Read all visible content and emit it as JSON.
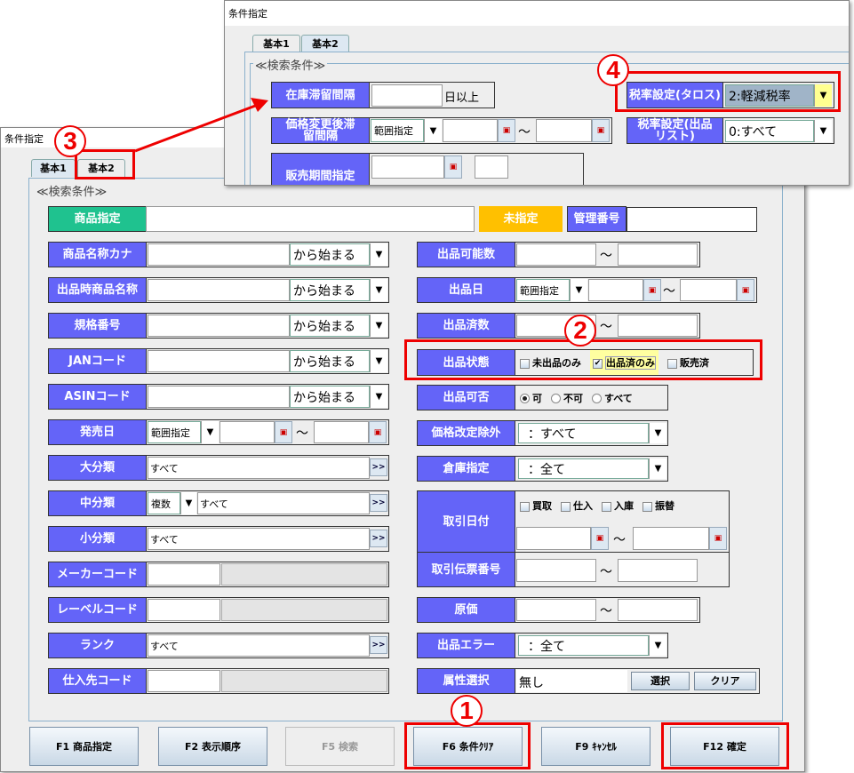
{
  "back_window": {
    "title": "条件指定",
    "tabs": [
      "基本1",
      "基本2"
    ],
    "group_label": "≪検索条件≫",
    "left": {
      "product_spec": "商品指定",
      "unspecified": "未指定",
      "mgmt_no": "管理番号",
      "name_kana": "商品名称カナ",
      "listing_name": "出品時商品名称",
      "model_no": "規格番号",
      "jan": "JANコード",
      "asin": "ASINコード",
      "match_option": "から始まる",
      "release_date": "発売日",
      "range": "範囲指定",
      "large_cat": "大分類",
      "all": "すべて",
      "mid_cat": "中分類",
      "multiple": "複数",
      "small_cat": "小分類",
      "maker_code": "メーカーコード",
      "label_code": "レーベルコード",
      "rank": "ランク",
      "supplier_code": "仕入先コード",
      "more": ">>",
      "tilde": "～"
    },
    "right": {
      "listable_qty": "出品可能数",
      "listing_date": "出品日",
      "listed_qty": "出品済数",
      "listing_status": "出品状態",
      "status_options": [
        "未出品のみ",
        "出品済のみ",
        "販売済"
      ],
      "status_checked": [
        false,
        true,
        false
      ],
      "listing_ok": "出品可否",
      "ok_options": [
        "可",
        "不可",
        "すべて"
      ],
      "ok_selected": "可",
      "price_excl": "価格改定除外",
      "price_excl_value": "：すべて",
      "warehouse": "倉庫指定",
      "warehouse_value": "：全て",
      "txn_date": "取引日付",
      "txn_types": [
        "買取",
        "仕入",
        "入庫",
        "振替"
      ],
      "txn_slip": "取引伝票番号",
      "cost": "原価",
      "listing_error": "出品エラー",
      "listing_error_value": "：全て",
      "attr_select": "属性選択",
      "attr_value": "無し",
      "select_btn": "選択",
      "clear_btn": "クリア"
    },
    "buttons": [
      "F1 商品指定",
      "F2 表示順序",
      "F5 検索",
      "F6 条件ｸﾘｱ",
      "F9 ｷｬﾝｾﾙ",
      "F12 確定"
    ]
  },
  "front_window": {
    "title": "条件指定",
    "tabs": [
      "基本1",
      "基本2"
    ],
    "group_label": "≪検索条件≫",
    "stock_days": "在庫滞留間隔",
    "days_or_more": "日以上",
    "after_price_change": "価格変更後滞留間隔",
    "range": "範囲指定",
    "sales_period": "販売期間指定",
    "tax_taros": "税率設定(タロス)",
    "tax_taros_value": "2:軽減税率",
    "tax_list": "税率設定(出品リスト)",
    "tax_list_value": "0:すべて"
  },
  "annotations": [
    "1",
    "2",
    "3",
    "4"
  ],
  "colors": {
    "label": "#6464f8",
    "product_label": "#1fc28f",
    "unspecified": "#ffc000",
    "annotation": "#ee0000"
  }
}
